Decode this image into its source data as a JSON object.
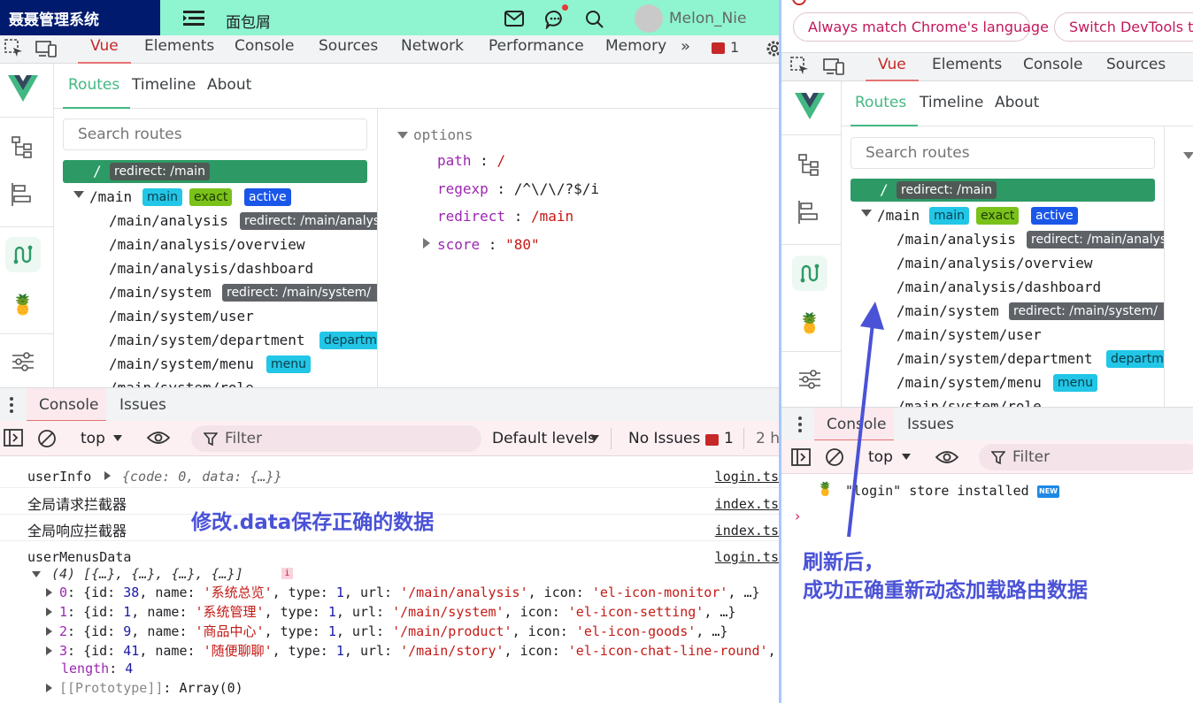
{
  "app": {
    "title": "聂聂管理系统",
    "breadcrumb": "面包屑",
    "username": "Melon_Nie"
  },
  "colors": {
    "sidebar": "#001a6e",
    "header": "#8ef5d0",
    "vue_green": "#42b883",
    "route_active": "#2d9a66",
    "annotation": "#4a52d6",
    "console_bg": "#fdf0f3"
  },
  "devtools_tabs": [
    "Vue",
    "Elements",
    "Console",
    "Sources",
    "Network",
    "Performance",
    "Memory"
  ],
  "issues_count": "1",
  "chrome_prompt": {
    "match_language": "Always match Chrome's language",
    "switch_devtools": "Switch DevTools to"
  },
  "vue_subtabs": [
    "Routes",
    "Timeline",
    "About"
  ],
  "search_routes_placeholder": "Search routes",
  "routes": {
    "root": {
      "path": "/",
      "badge": "redirect: /main"
    },
    "main": {
      "path": "/main",
      "badges": [
        "main",
        "exact",
        "active"
      ]
    },
    "items": [
      {
        "path": "/main/analysis",
        "badge": "redirect: /main/analysis"
      },
      {
        "path": "/main/analysis/overview"
      },
      {
        "path": "/main/analysis/dashboard"
      },
      {
        "path": "/main/system",
        "badge": "redirect: /main/system/"
      },
      {
        "path": "/main/system/user"
      },
      {
        "path": "/main/system/department",
        "badge": "department"
      },
      {
        "path": "/main/system/menu",
        "badge": "menu"
      },
      {
        "path": "/main/system/role"
      }
    ]
  },
  "options": {
    "label": "options",
    "path_key": "path",
    "path_val": "/",
    "regexp_key": "regexp",
    "regexp_val": "/^\\/\\/?$/i",
    "redirect_key": "redirect",
    "redirect_val": "/main",
    "score_key": "score",
    "score_val": "\"80\""
  },
  "drawer_tabs": [
    "Console",
    "Issues"
  ],
  "console_toolbar": {
    "context": "top",
    "filter_placeholder": "Filter",
    "levels": "Default levels",
    "no_issues": "No Issues",
    "issues_count": "1",
    "hidden": "2 h"
  },
  "console_lines": {
    "userinfo_label": "userInfo",
    "userinfo_obj": "{code: 0, data: {…}}",
    "userinfo_src": "login.ts",
    "req_interceptor": "全局请求拦截器",
    "req_src": "index.ts",
    "res_interceptor": "全局响应拦截器",
    "res_src": "index.ts",
    "menus_label": "userMenusData",
    "menus_src": "login.ts",
    "array_summary": "(4)  [{…}, {…}, {…}, {…}]",
    "menu_items": [
      {
        "idx": "0",
        "id": "38",
        "name": "'系统总览'",
        "type": "1",
        "url": "'/main/analysis'",
        "icon": "'el-icon-monitor'",
        "tail": "…}"
      },
      {
        "idx": "1",
        "id": "1",
        "name": "'系统管理'",
        "type": "1",
        "url": "'/main/system'",
        "icon": "'el-icon-setting'",
        "tail": "…}"
      },
      {
        "idx": "2",
        "id": "9",
        "name": "'商品中心'",
        "type": "1",
        "url": "'/main/product'",
        "icon": "'el-icon-goods'",
        "tail": "…}"
      },
      {
        "idx": "3",
        "id": "41",
        "name": "'随便聊聊'",
        "type": "1",
        "url": "'/main/story'",
        "icon": "'el-icon-chat-line-round'",
        "tail": ""
      }
    ],
    "length_key": "length",
    "length_val": "4",
    "prototype": "[[Prototype]]",
    "prototype_val": "Array(0)"
  },
  "right_console": {
    "store_msg": "\"login\" store installed",
    "new_badge": "NEW"
  },
  "annotations": {
    "left": "修改.data保存正确的数据",
    "right_line1": "刷新后，",
    "right_line2": "成功正确重新动态加载路由数据"
  }
}
